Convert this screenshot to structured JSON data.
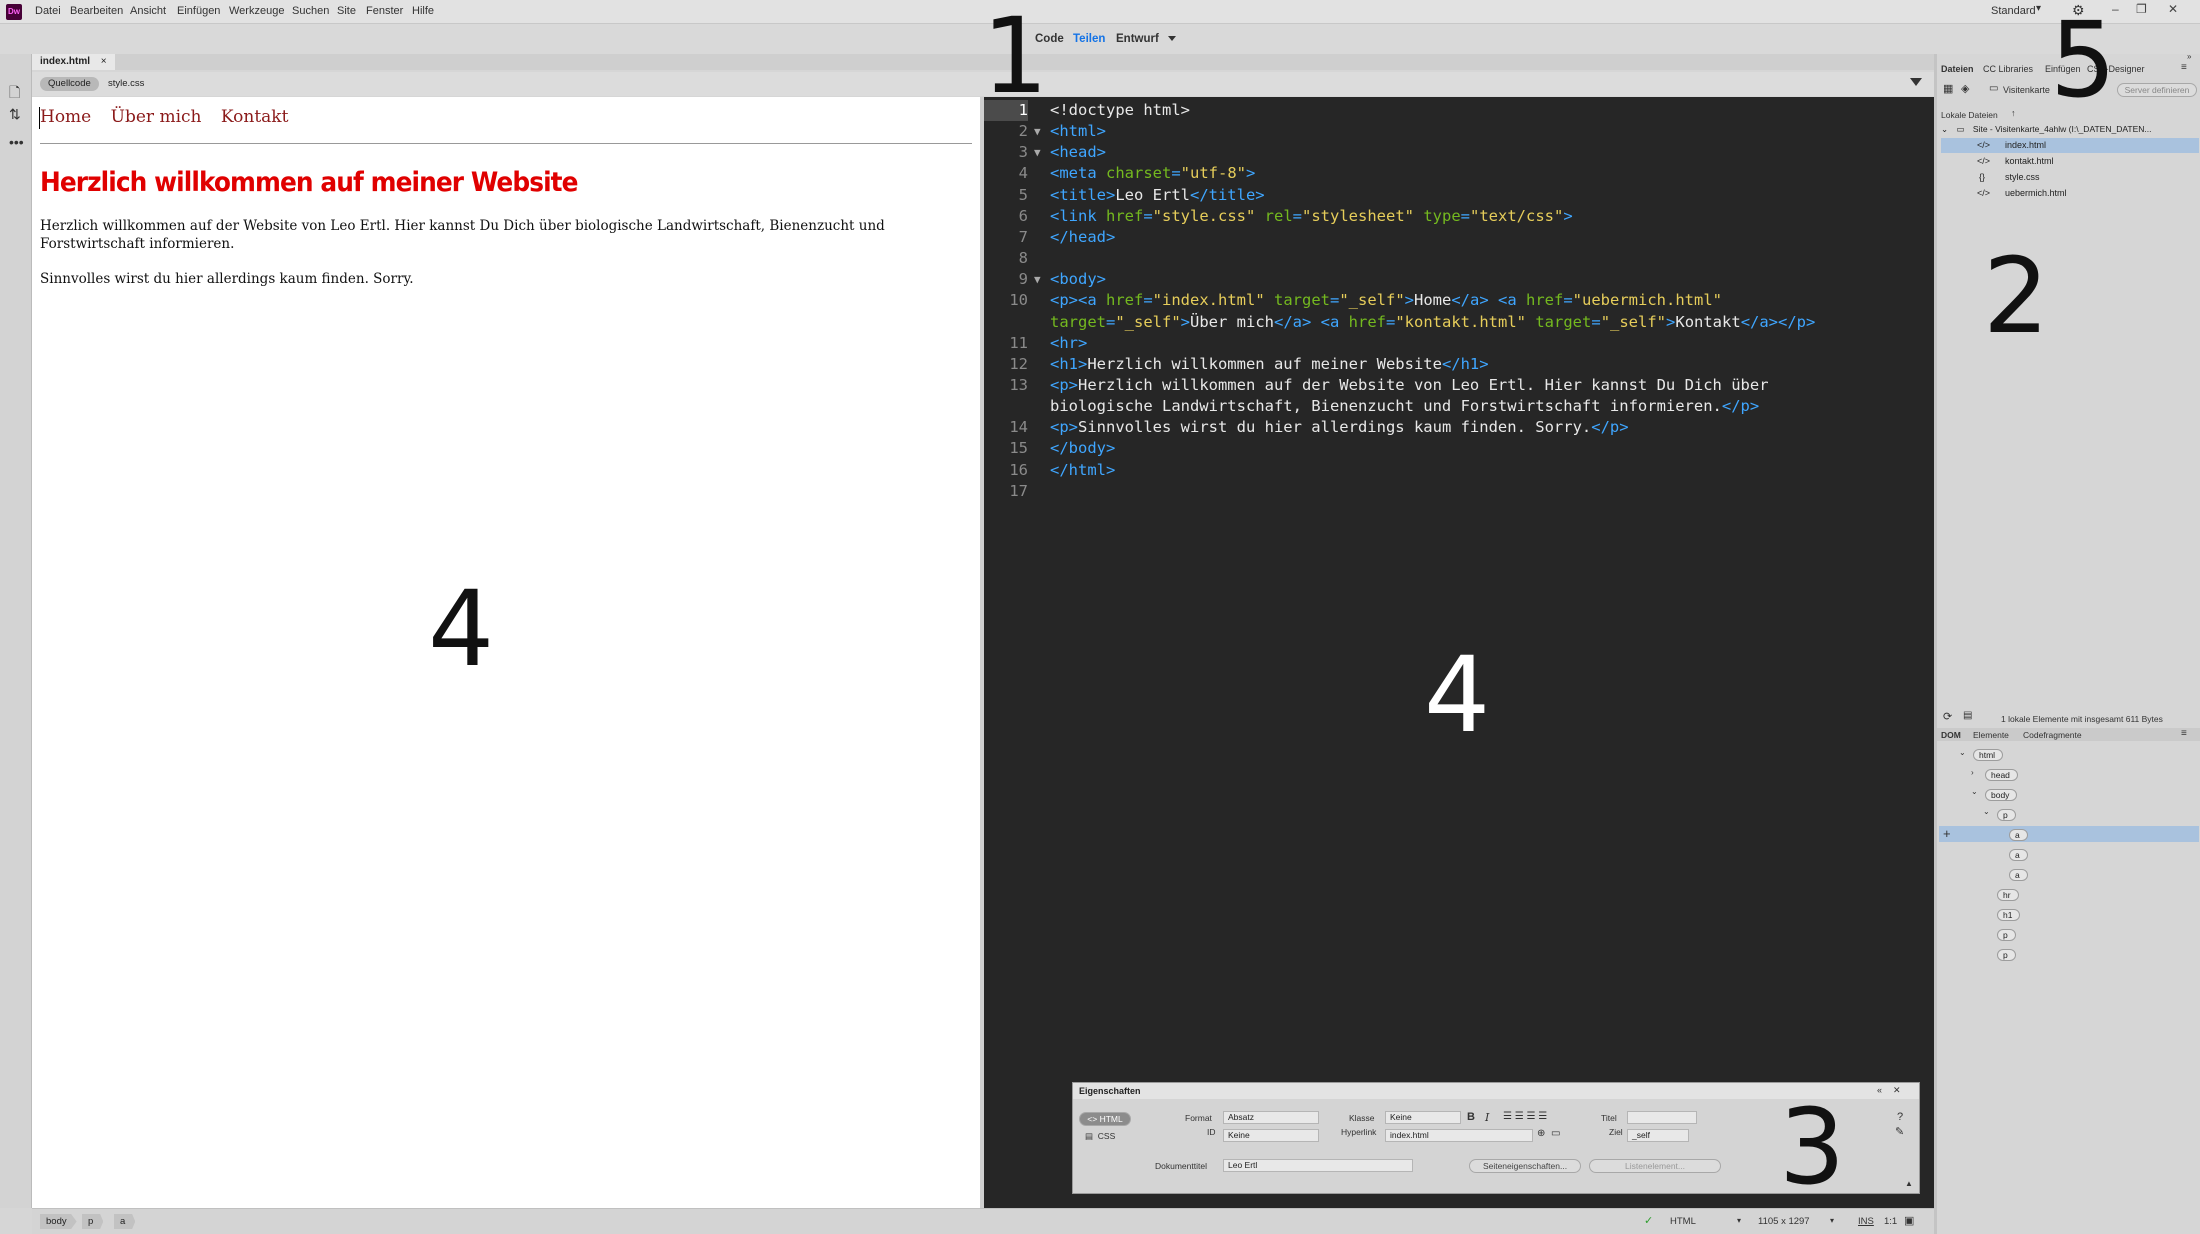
{
  "app": {
    "logo": "Dw"
  },
  "menu": [
    "Datei",
    "Bearbeiten",
    "Ansicht",
    "Einfügen",
    "Werkzeuge",
    "Suchen",
    "Site",
    "Fenster",
    "Hilfe"
  ],
  "view_switcher": {
    "code": "Code",
    "split": "Teilen",
    "design": "Entwurf"
  },
  "workspace": "Standard",
  "annotations": [
    "1",
    "2",
    "3",
    "4",
    "4",
    "5"
  ],
  "document_tabs": {
    "active": "index.html",
    "close": "×"
  },
  "related_files": {
    "source": "Quellcode",
    "css": "style.css"
  },
  "live": {
    "nav": [
      "Home",
      "Über mich",
      "Kontakt"
    ],
    "h1": "Herzlich willkommen auf meiner Website",
    "p1": "Herzlich willkommen auf der Website von Leo Ertl. Hier kannst Du Dich über biologische Landwirtschaft, Bienenzucht und Forstwirtschaft informieren.",
    "p2": "Sinnvolles wirst du hier allerdings kaum finden. Sorry."
  },
  "code": {
    "line_numbers": [
      "1",
      "2",
      "3",
      "4",
      "5",
      "6",
      "7",
      "8",
      "9",
      "10",
      "",
      "11",
      "12",
      "13",
      "",
      "14",
      "15",
      "16",
      "17"
    ]
  },
  "properties": {
    "title": "Eigenschaften",
    "html_btn": "HTML",
    "css_btn": "CSS",
    "format_label": "Format",
    "format_value": "Absatz",
    "id_label": "ID",
    "id_value": "Keine",
    "class_label": "Klasse",
    "class_value": "Keine",
    "link_label": "Hyperlink",
    "link_value": "index.html",
    "title_label": "Titel",
    "target_label": "Ziel",
    "target_value": "_self",
    "doc_title_label": "Dokumenttitel",
    "doc_title_value": "Leo Ertl",
    "page_props": "Seiteneigenschaften...",
    "list_item": "Listenelement..."
  },
  "status": {
    "tags": [
      "body",
      "p",
      "a"
    ],
    "language": "HTML",
    "size": "1105 x 1297",
    "mode": "INS",
    "position": "1:1"
  },
  "files_panel": {
    "tabs": [
      "Dateien",
      "CC Libraries",
      "Einfügen",
      "CSS-Designer"
    ],
    "site_select": "Visitenkarte",
    "server_btn": "Server definieren",
    "local_label": "Lokale Dateien",
    "site_root": "Site - Visitenkarte_4ahlw (I:\\_DATEN_DATEN...",
    "files": [
      {
        "icon": "</>",
        "name": "index.html"
      },
      {
        "icon": "</>",
        "name": "kontakt.html"
      },
      {
        "icon": "{}",
        "name": "style.css"
      },
      {
        "icon": "</>",
        "name": "uebermich.html"
      }
    ],
    "summary": "1 lokale Elemente mit insgesamt 611 Bytes"
  },
  "dom_panel": {
    "tabs": [
      "DOM",
      "Elemente",
      "Codefragmente"
    ],
    "nodes": [
      "html",
      "head",
      "body",
      "p",
      "a",
      "a",
      "a",
      "hr",
      "h1",
      "p",
      "p"
    ]
  }
}
